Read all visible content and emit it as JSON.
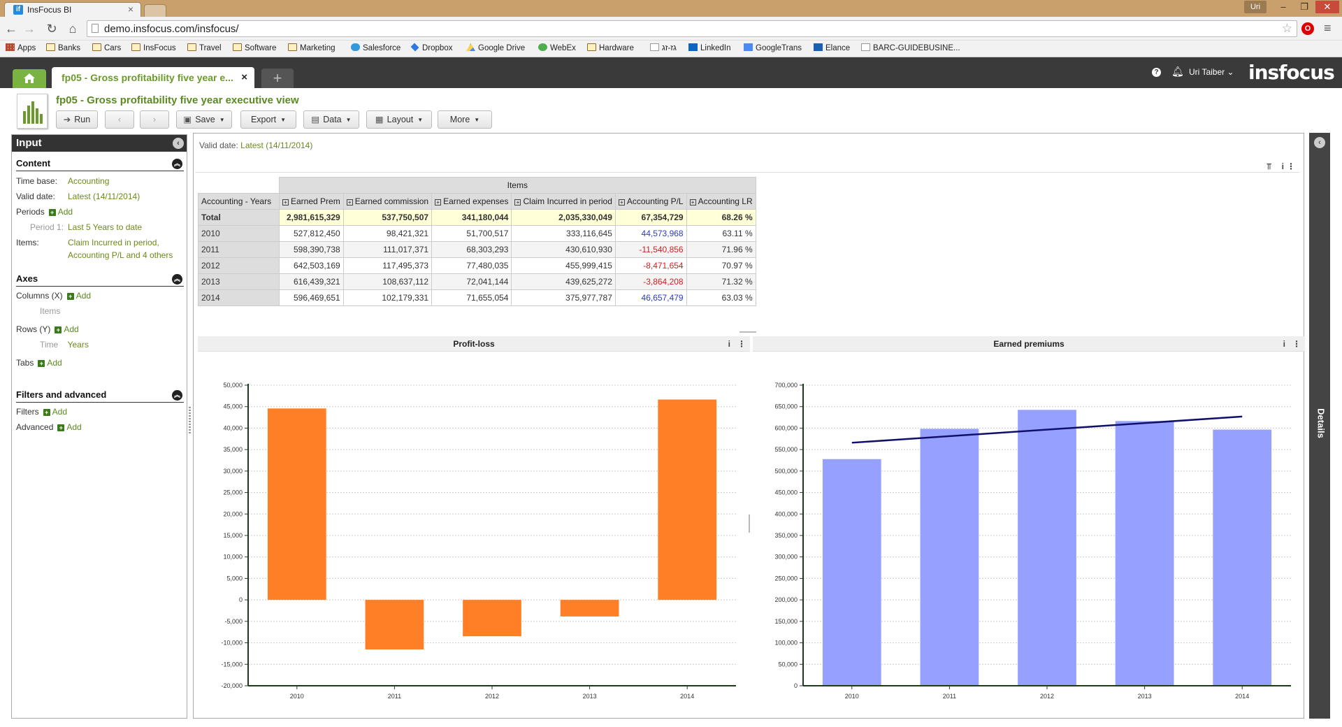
{
  "browser": {
    "tab_title": "InsFocus BI",
    "tab_favicon": "if",
    "user_badge": "Uri",
    "url": "demo.insfocus.com/insfocus/",
    "bookmarks": [
      "Apps",
      "Banks",
      "Cars",
      "InsFocus",
      "Travel",
      "Software",
      "Marketing",
      "Salesforce",
      "Dropbox",
      "Google Drive",
      "WebEx",
      "Hardware",
      "גז-זג",
      "LinkedIn",
      "GoogleTrans",
      "Elance",
      "BARC-GUIDEBUSINE..."
    ]
  },
  "app": {
    "report_tab_title": "fp05 - Gross profitability five year e...",
    "user_name": "Uri Taiber",
    "logo": "insfocus",
    "accent_color": "#7bb342"
  },
  "report": {
    "title": "fp05 - Gross profitability five year executive view",
    "toolbar": {
      "run": "Run",
      "save": "Save",
      "export": "Export",
      "data": "Data",
      "layout": "Layout",
      "more": "More"
    }
  },
  "sidebar": {
    "title": "Input",
    "content": {
      "header": "Content",
      "time_base_label": "Time base:",
      "time_base_value": "Accounting",
      "valid_date_label": "Valid date:",
      "valid_date_value": "Latest (14/11/2014)",
      "periods_label": "Periods",
      "add": "Add",
      "period1_label": "Period 1:",
      "period1_value": "Last 5 Years to date",
      "items_label": "Items:",
      "items_value_1": "Claim Incurred in period,",
      "items_value_2": "Accounting P/L and 4 others"
    },
    "axes": {
      "header": "Axes",
      "columns_label": "Columns (X)",
      "columns_item": "Items",
      "rows_label": "Rows (Y)",
      "rows_item_dim": "Time",
      "rows_item_val": "Years",
      "tabs_label": "Tabs"
    },
    "filters": {
      "header": "Filters and advanced",
      "filters_label": "Filters",
      "advanced_label": "Advanced"
    }
  },
  "main": {
    "valid_date_label": "Valid date:",
    "valid_date_value": "Latest (14/11/2014)",
    "table": {
      "group_header": "Items",
      "corner_header": "Accounting - Years",
      "columns": [
        "Earned Prem",
        "Earned commission",
        "Earned expenses",
        "Claim Incurred in period",
        "Accounting P/L",
        "Accounting LR"
      ],
      "rows": [
        {
          "label": "Total",
          "values": [
            "2,981,615,329",
            "537,750,507",
            "341,180,044",
            "2,035,330,049",
            "67,354,729",
            "68.26 %"
          ],
          "pl_sign": "total"
        },
        {
          "label": "2010",
          "values": [
            "527,812,450",
            "98,421,321",
            "51,700,517",
            "333,116,645",
            "44,573,968",
            "63.11 %"
          ],
          "pl_sign": "pos"
        },
        {
          "label": "2011",
          "values": [
            "598,390,738",
            "111,017,371",
            "68,303,293",
            "430,610,930",
            "-11,540,856",
            "71.96 %"
          ],
          "pl_sign": "neg"
        },
        {
          "label": "2012",
          "values": [
            "642,503,169",
            "117,495,373",
            "77,480,035",
            "455,999,415",
            "-8,471,654",
            "70.97 %"
          ],
          "pl_sign": "neg"
        },
        {
          "label": "2013",
          "values": [
            "616,439,321",
            "108,637,112",
            "72,041,144",
            "439,625,272",
            "-3,864,208",
            "71.32 %"
          ],
          "pl_sign": "neg"
        },
        {
          "label": "2014",
          "values": [
            "596,469,651",
            "102,179,331",
            "71,655,054",
            "375,977,787",
            "46,657,479",
            "63.03 %"
          ],
          "pl_sign": "pos"
        }
      ]
    },
    "details_label": "Details"
  },
  "chart_data": [
    {
      "type": "bar",
      "title": "Profit-loss",
      "categories": [
        "2010",
        "2011",
        "2012",
        "2013",
        "2014"
      ],
      "values": [
        44573.968,
        -11540.856,
        -8471.654,
        -3864.208,
        46657.479
      ],
      "ylim": [
        -20000,
        50000
      ],
      "yticks": [
        50000,
        45000,
        40000,
        35000,
        30000,
        25000,
        20000,
        15000,
        10000,
        5000,
        0,
        -5000,
        -10000,
        -15000,
        -20000
      ],
      "ytick_labels": [
        "50,000",
        "45,000",
        "40,000",
        "35,000",
        "30,000",
        "25,000",
        "20,000",
        "15,000",
        "10,000",
        "5,000",
        "0",
        "-5,000",
        "-10,000",
        "-15,000",
        "-20,000"
      ],
      "color": "#ff7f27",
      "grid": true
    },
    {
      "type": "bar",
      "title": "Earned premiums",
      "categories": [
        "2010",
        "2011",
        "2012",
        "2013",
        "2014"
      ],
      "values": [
        527812.45,
        598390.738,
        642503.169,
        616439.321,
        596469.651
      ],
      "trendline": [
        566000,
        581000,
        596000,
        611000,
        627000
      ],
      "ylim": [
        0,
        700000
      ],
      "yticks": [
        700000,
        650000,
        600000,
        550000,
        500000,
        450000,
        400000,
        350000,
        300000,
        250000,
        200000,
        150000,
        100000,
        50000,
        0
      ],
      "ytick_labels": [
        "700,000",
        "650,000",
        "600,000",
        "550,000",
        "500,000",
        "450,000",
        "400,000",
        "350,000",
        "300,000",
        "250,000",
        "200,000",
        "150,000",
        "100,000",
        "50,000",
        "0"
      ],
      "color": "#96a0ff",
      "trend_color": "#10106a",
      "grid": true
    }
  ]
}
